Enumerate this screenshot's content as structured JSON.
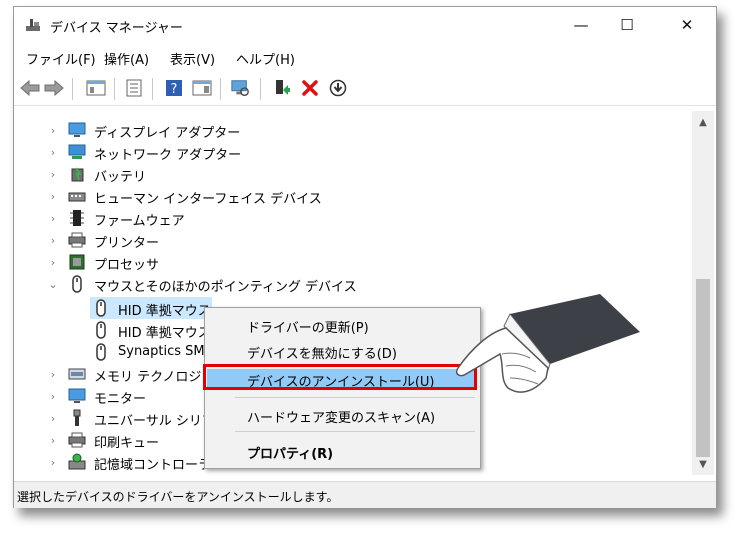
{
  "window": {
    "title": "デバイス マネージャー",
    "controls": {
      "minimize": "—",
      "maximize": "☐",
      "close": "✕"
    }
  },
  "menu": [
    "ファイル(F)",
    "操作(A)",
    "表示(V)",
    "ヘルプ(H)"
  ],
  "tree": {
    "categories": [
      "ディスプレイ アダプター",
      "ネットワーク アダプター",
      "バッテリ",
      "ヒューマン インターフェイス デバイス",
      "ファームウェア",
      "プリンター",
      "プロセッサ",
      "マウスとそのほかのポインティング デバイス"
    ],
    "mouse_children": [
      "HID 準拠マウス",
      "HID 準拠マウス",
      "Synaptics SM"
    ],
    "categories_after": [
      "メモリ テクノロジ デ",
      "モニター",
      "ユニバーサル シリアル",
      "印刷キュー",
      "記憶域コントローラー"
    ]
  },
  "context_menu": {
    "items": [
      "ドライバーの更新(P)",
      "デバイスを無効にする(D)",
      "デバイスのアンインストール(U)",
      "ハードウェア変更のスキャン(A)",
      "プロパティ(R)"
    ]
  },
  "status": "選択したデバイスのドライバーをアンインストールします。",
  "colors": {
    "selection": "#cce8ff",
    "menu_highlight": "#91c9f7",
    "callout_red": "#e30000"
  }
}
